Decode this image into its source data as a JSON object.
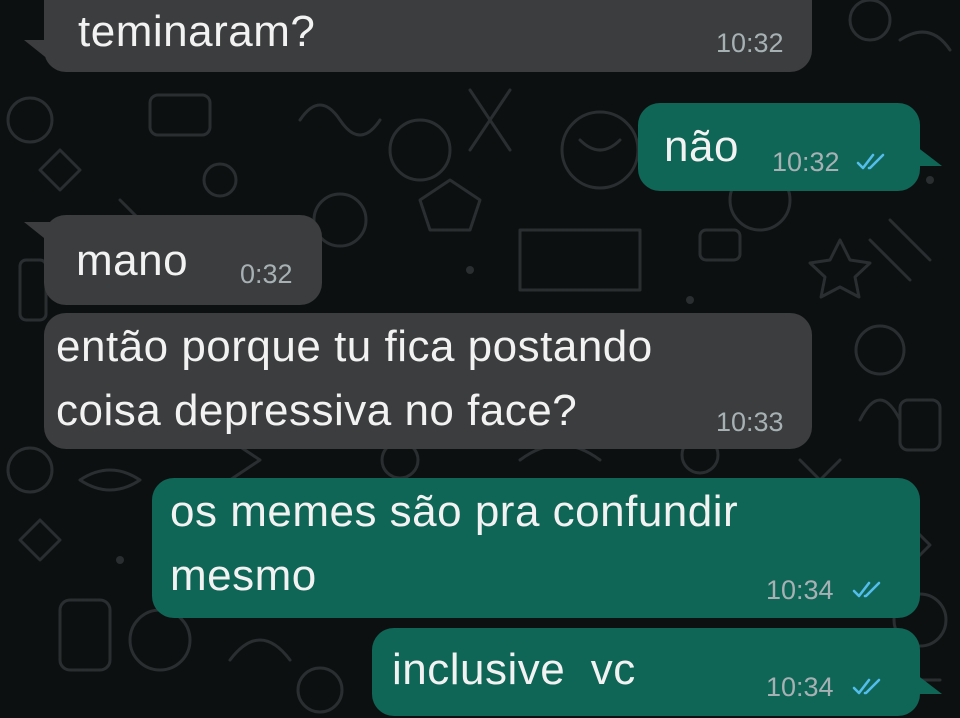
{
  "messages": [
    {
      "id": "m1",
      "direction": "incoming",
      "text": "teminaram?",
      "time": "10:32"
    },
    {
      "id": "m2",
      "direction": "outgoing",
      "text": "não",
      "time": "10:32",
      "status": "read"
    },
    {
      "id": "m3",
      "direction": "incoming",
      "text": "mano",
      "time": "0:32"
    },
    {
      "id": "m4",
      "direction": "incoming",
      "text_lines": [
        "então porque tu fica postando",
        "coisa depressiva no face?"
      ],
      "time": "10:33"
    },
    {
      "id": "m5",
      "direction": "outgoing",
      "text_lines": [
        "os memes são pra confundir",
        "mesmo"
      ],
      "time": "10:34",
      "status": "read"
    },
    {
      "id": "m6",
      "direction": "outgoing",
      "text": "inclusive  vc",
      "time": "10:34",
      "status": "read"
    }
  ],
  "colors": {
    "background": "#0d1011",
    "incoming_bubble": "#3b3d3e",
    "outgoing_bubble": "#0f6656",
    "text": "#f2f2f2",
    "timestamp": "#a7b1b4",
    "read_ticks": "#53bdeb"
  },
  "icons": {
    "read_receipt": "double-check-icon"
  }
}
